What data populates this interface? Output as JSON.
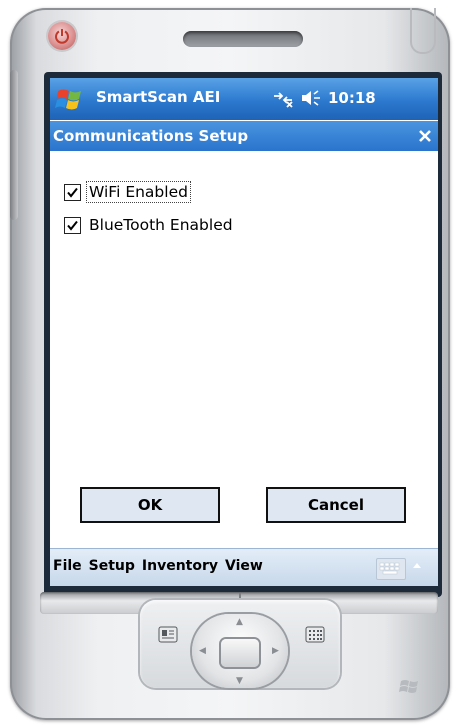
{
  "device": {
    "icons": [
      "power-icon",
      "windows-start-icon",
      "connectivity-icon",
      "speaker-icon",
      "close-icon",
      "keyboard-icon",
      "windows-logo-icon"
    ]
  },
  "titlebar": {
    "app_name": "SmartScan AEI",
    "time": "10:18"
  },
  "dialog": {
    "title": "Communications Setup",
    "options": [
      {
        "label": "WiFi Enabled",
        "checked": true
      },
      {
        "label": "BlueTooth Enabled",
        "checked": true
      }
    ],
    "ok_label": "OK",
    "cancel_label": "Cancel"
  },
  "menubar": {
    "items": [
      "File",
      "Setup",
      "Inventory",
      "View"
    ]
  },
  "colors": {
    "titlebar_blue": "#2c79cf",
    "button_fill": "#dfe8f2",
    "menubar_fill": "#d4e2f1"
  }
}
